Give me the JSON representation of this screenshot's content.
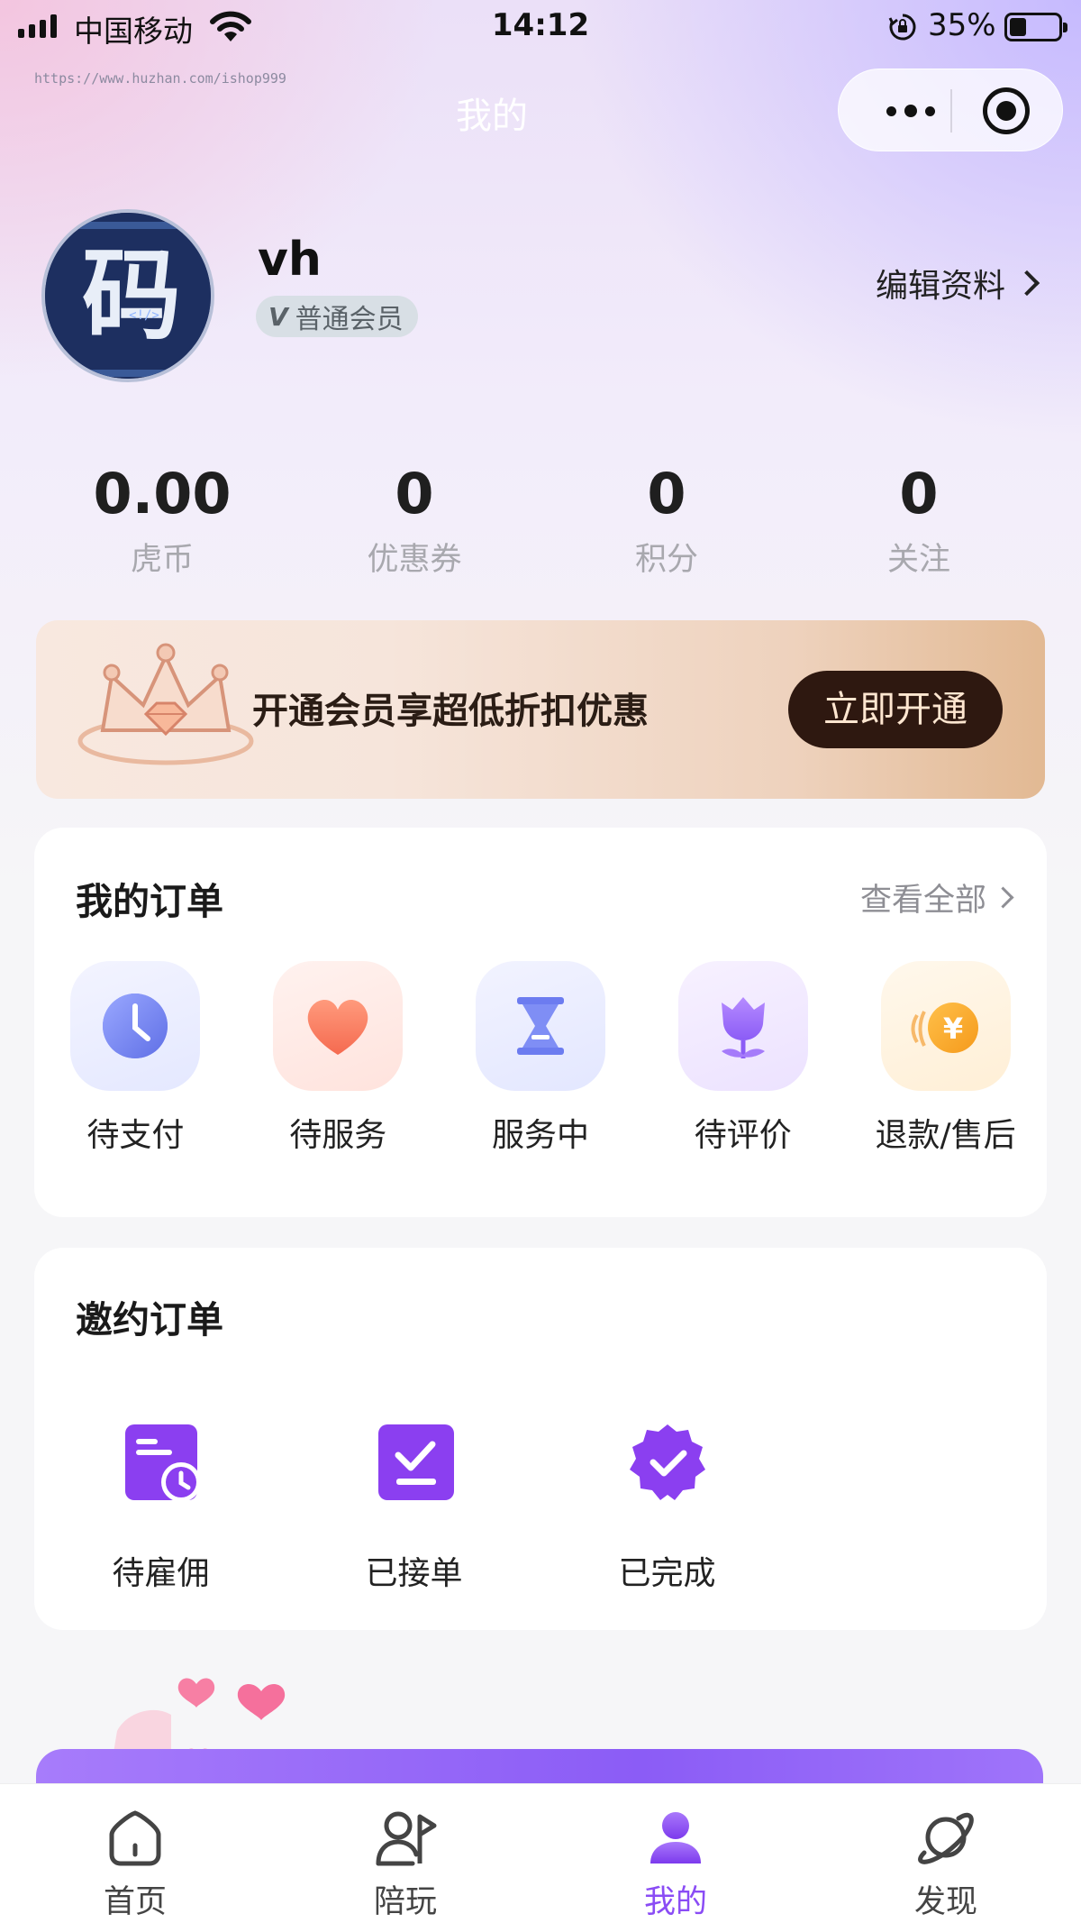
{
  "status_bar": {
    "carrier": "中国移动",
    "time": "14:12",
    "battery": "35%"
  },
  "watermark": "https://www.huzhan.com/ishop999",
  "nav": {
    "title": "我的",
    "more_icon": "more-dots-icon",
    "close_icon": "target-circle-icon"
  },
  "profile": {
    "avatar_text": "码",
    "avatar_code": "<!/>",
    "username": "vh",
    "member_badge_icon": "V",
    "member_level": "普通会员",
    "edit_label": "编辑资料"
  },
  "stats": [
    {
      "value": "0.00",
      "label": "虎币"
    },
    {
      "value": "0",
      "label": "优惠券"
    },
    {
      "value": "0",
      "label": "积分"
    },
    {
      "value": "0",
      "label": "关注"
    }
  ],
  "vip_banner": {
    "text": "开通会员享超低折扣优惠",
    "button": "立即开通"
  },
  "my_orders": {
    "title": "我的订单",
    "view_all": "查看全部",
    "items": [
      {
        "label": "待支付",
        "icon": "clock-icon"
      },
      {
        "label": "待服务",
        "icon": "heart-icon"
      },
      {
        "label": "服务中",
        "icon": "hourglass-icon"
      },
      {
        "label": "待评价",
        "icon": "flower-icon"
      },
      {
        "label": "退款/售后",
        "icon": "yuan-coin-icon",
        "symbol": "¥"
      }
    ]
  },
  "invite_orders": {
    "title": "邀约订单",
    "items": [
      {
        "label": "待雇佣",
        "icon": "calendar-clock-icon"
      },
      {
        "label": "已接单",
        "icon": "check-square-icon"
      },
      {
        "label": "已完成",
        "icon": "verified-badge-icon"
      }
    ]
  },
  "tabbar": [
    {
      "label": "首页",
      "icon": "home-icon",
      "active": false
    },
    {
      "label": "陪玩",
      "icon": "companion-icon",
      "active": false
    },
    {
      "label": "我的",
      "icon": "profile-icon",
      "active": true
    },
    {
      "label": "发现",
      "icon": "planet-icon",
      "active": false
    }
  ],
  "colors": {
    "accent": "#8a4cf5",
    "vip_button": "#2e1810",
    "gold": "#f5a623"
  }
}
